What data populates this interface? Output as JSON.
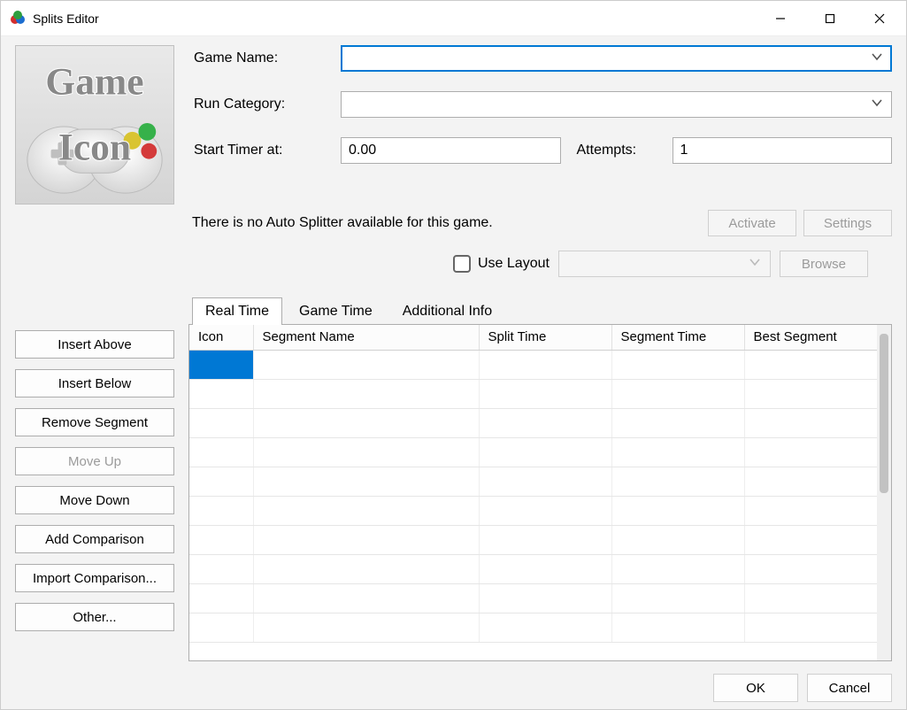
{
  "window": {
    "title": "Splits Editor"
  },
  "form": {
    "game_name_label": "Game Name:",
    "game_name_value": "",
    "run_category_label": "Run Category:",
    "run_category_value": "",
    "start_timer_label": "Start Timer at:",
    "start_timer_value": "0.00",
    "attempts_label": "Attempts:",
    "attempts_value": "1"
  },
  "game_icon_text": {
    "line1": "Game",
    "line2": "Icon"
  },
  "autosplitter": {
    "status": "There is no Auto Splitter available for this game.",
    "activate_label": "Activate",
    "settings_label": "Settings"
  },
  "layout": {
    "use_layout_label": "Use Layout",
    "browse_label": "Browse"
  },
  "tabs": {
    "real_time": "Real Time",
    "game_time": "Game Time",
    "additional_info": "Additional Info"
  },
  "columns": {
    "icon": "Icon",
    "segment_name": "Segment Name",
    "split_time": "Split Time",
    "segment_time": "Segment Time",
    "best_segment": "Best Segment"
  },
  "segments": [
    {
      "icon": "",
      "name": "",
      "split": "",
      "segment": "",
      "best": "",
      "selected": true
    },
    {
      "icon": "",
      "name": "",
      "split": "",
      "segment": "",
      "best": ""
    },
    {
      "icon": "",
      "name": "",
      "split": "",
      "segment": "",
      "best": ""
    },
    {
      "icon": "",
      "name": "",
      "split": "",
      "segment": "",
      "best": ""
    },
    {
      "icon": "",
      "name": "",
      "split": "",
      "segment": "",
      "best": ""
    },
    {
      "icon": "",
      "name": "",
      "split": "",
      "segment": "",
      "best": ""
    },
    {
      "icon": "",
      "name": "",
      "split": "",
      "segment": "",
      "best": ""
    },
    {
      "icon": "",
      "name": "",
      "split": "",
      "segment": "",
      "best": ""
    },
    {
      "icon": "",
      "name": "",
      "split": "",
      "segment": "",
      "best": ""
    },
    {
      "icon": "",
      "name": "",
      "split": "",
      "segment": "",
      "best": ""
    }
  ],
  "side_buttons": {
    "insert_above": "Insert Above",
    "insert_below": "Insert Below",
    "remove_segment": "Remove Segment",
    "move_up": "Move Up",
    "move_down": "Move Down",
    "add_comparison": "Add Comparison",
    "import_comparison": "Import Comparison...",
    "other": "Other..."
  },
  "footer": {
    "ok": "OK",
    "cancel": "Cancel"
  }
}
